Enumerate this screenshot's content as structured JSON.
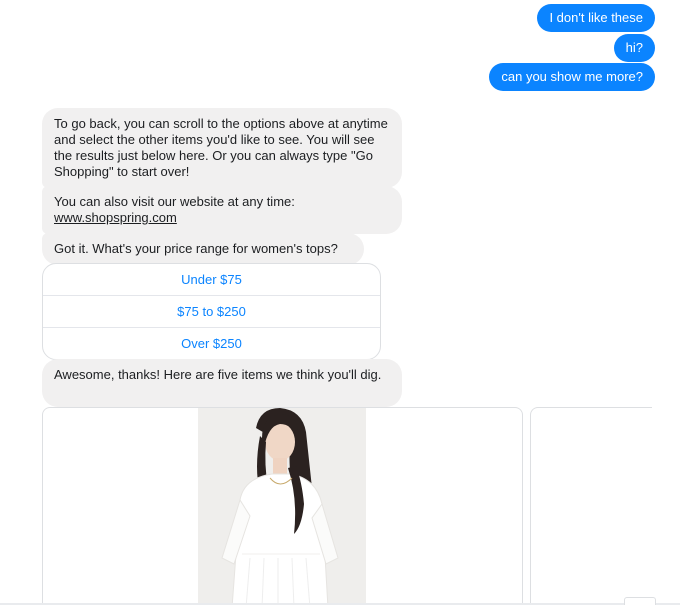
{
  "outgoing": [
    {
      "text": "I don't like these"
    },
    {
      "text": "hi?"
    },
    {
      "text": "can you show me more?"
    }
  ],
  "incoming": [
    {
      "text": "To go back, you can scroll to the options above at anytime and select the other items you'd like to see. You will see the results just below here. Or you can always type \"Go Shopping\" to start over!"
    },
    {
      "text_prefix": "You can also visit our website at any time:",
      "link": "www.shopspring.com"
    },
    {
      "text": "Got it. What's your price range for women's tops?"
    },
    {
      "text": "Awesome, thanks! Here are five items we think you'll dig."
    }
  ],
  "quick_replies": [
    {
      "label": "Under $75"
    },
    {
      "label": "$75 to $250"
    },
    {
      "label": "Over $250"
    }
  ],
  "colors": {
    "outgoing_bubble": "#0b84ff",
    "incoming_bubble": "#f1f0f0",
    "quick_reply_text": "#0b84ff"
  }
}
